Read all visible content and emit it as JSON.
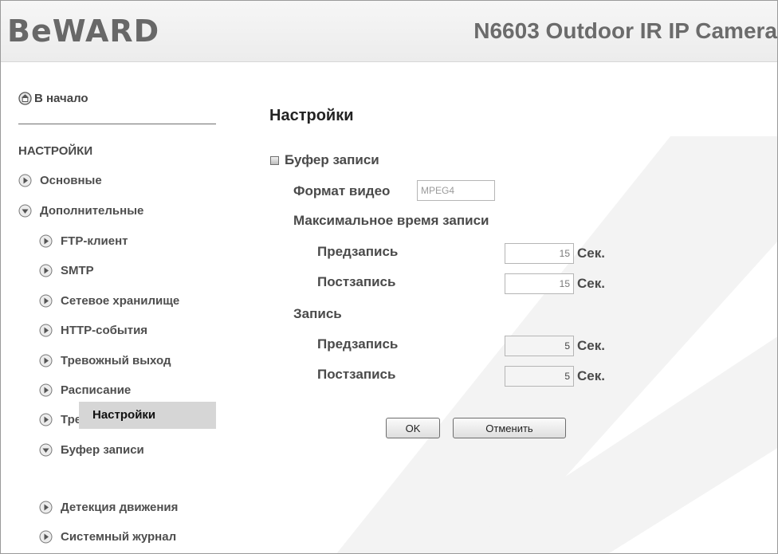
{
  "header": {
    "logo": "BeWARD",
    "model": "N6603 Outdoor IR IP Camera"
  },
  "sidebar": {
    "home": "В начало",
    "section_title": "НАСТРОЙКИ",
    "items": [
      {
        "label": "Основные",
        "expanded": false
      },
      {
        "label": "Дополнительные",
        "expanded": true
      },
      {
        "label": "FTP-клиент",
        "expanded": false
      },
      {
        "label": "SMTP",
        "expanded": false
      },
      {
        "label": "Сетевое хранилище",
        "expanded": false
      },
      {
        "label": "HTTP-события",
        "expanded": false
      },
      {
        "label": "Тревожный выход",
        "expanded": false
      },
      {
        "label": "Расписание",
        "expanded": false
      },
      {
        "label": "Тревожный вход",
        "expanded": false
      },
      {
        "label": "Буфер записи",
        "expanded": true
      },
      {
        "label": "Детекция движения",
        "expanded": false
      },
      {
        "label": "Системный журнал",
        "expanded": false
      }
    ],
    "active": "Настройки"
  },
  "main": {
    "title": "Настройки",
    "section": "Буфер записи",
    "video_format": {
      "label": "Формат видео",
      "value": "MPEG4"
    },
    "max_record_time": {
      "label": "Максимальное время записи",
      "pre": {
        "label": "Предзапись",
        "value": "15",
        "unit": "Сек."
      },
      "post": {
        "label": "Постзапись",
        "value": "15",
        "unit": "Сек."
      }
    },
    "record": {
      "label": "Запись",
      "pre": {
        "label": "Предзапись",
        "value": "5",
        "unit": "Сек."
      },
      "post": {
        "label": "Постзапись",
        "value": "5",
        "unit": "Сек."
      }
    },
    "buttons": {
      "ok": "OK",
      "cancel": "Отменить"
    }
  },
  "colors": {
    "header_bg": "#ececec",
    "active_item": "#d6d6d6",
    "text": "#4a4a4a",
    "watermark": "#f4f4f4"
  }
}
